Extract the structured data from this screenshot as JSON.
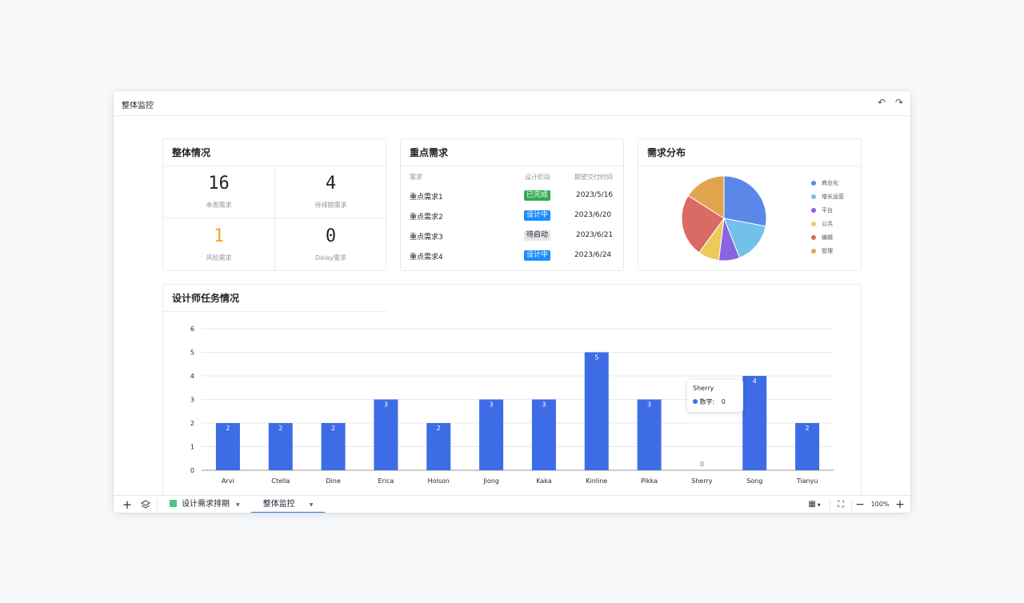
{
  "window": {
    "title": "整体监控"
  },
  "overall": {
    "title": "整体情况",
    "kpis": [
      {
        "value": "16",
        "label": "本周需求"
      },
      {
        "value": "4",
        "label": "待排期需求"
      },
      {
        "value": "1",
        "label": "风险需求"
      },
      {
        "value": "0",
        "label": "Delay需求"
      }
    ]
  },
  "key_demands": {
    "title": "重点需求",
    "headers": [
      "需求",
      "设计阶段",
      "期望交付时间"
    ],
    "rows": [
      {
        "name": "重点需求1",
        "stage": "已完成",
        "date": "2023/5/16"
      },
      {
        "name": "重点需求2",
        "stage": "设计中",
        "date": "2023/6/20"
      },
      {
        "name": "重点需求3",
        "stage": "待启动",
        "date": "2023/6/21"
      },
      {
        "name": "重点需求4",
        "stage": "设计中",
        "date": "2023/6/24"
      }
    ]
  },
  "distribution": {
    "title": "需求分布",
    "legend": [
      {
        "name": "商业化",
        "color": "#5b87e8"
      },
      {
        "name": "增长运营",
        "color": "#72c1ea"
      },
      {
        "name": "平台",
        "color": "#8a63e0"
      },
      {
        "name": "公共",
        "color": "#ecca5a"
      },
      {
        "name": "编辑",
        "color": "#d96a64"
      },
      {
        "name": "管理",
        "color": "#e2a34f"
      }
    ]
  },
  "chart_data": [
    {
      "type": "pie",
      "categories": [
        "商业化",
        "增长运营",
        "平台",
        "公共",
        "编辑",
        "管理"
      ],
      "values": [
        28,
        16,
        8,
        8,
        24,
        16
      ],
      "colors": [
        "#5b87e8",
        "#72c1ea",
        "#8a63e0",
        "#ecca5a",
        "#d96a64",
        "#e2a34f"
      ],
      "legend": "right"
    },
    {
      "type": "bar",
      "title": "设计师任务情况",
      "categories": [
        "Arvi",
        "Ctella",
        "Dine",
        "Erica",
        "Holson",
        "Jiong",
        "Kaka",
        "Kinline",
        "Pikka",
        "Sherry",
        "Song",
        "Tianyu"
      ],
      "values": [
        2,
        2,
        2,
        3,
        2,
        3,
        3,
        5,
        3,
        0,
        4,
        2
      ],
      "yticks": [
        0,
        1,
        2,
        3,
        4,
        5,
        6
      ],
      "ylim": [
        0,
        6
      ],
      "color": "#3d6ce6",
      "grid": true,
      "tooltip": {
        "category": "Sherry",
        "series": "数字",
        "value": "0"
      }
    }
  ],
  "tasks": {
    "title": "设计师任务情况"
  },
  "bottom": {
    "tabs": [
      {
        "label": "设计需求排期"
      },
      {
        "label": "整体监控"
      }
    ],
    "zoom": "100%"
  }
}
